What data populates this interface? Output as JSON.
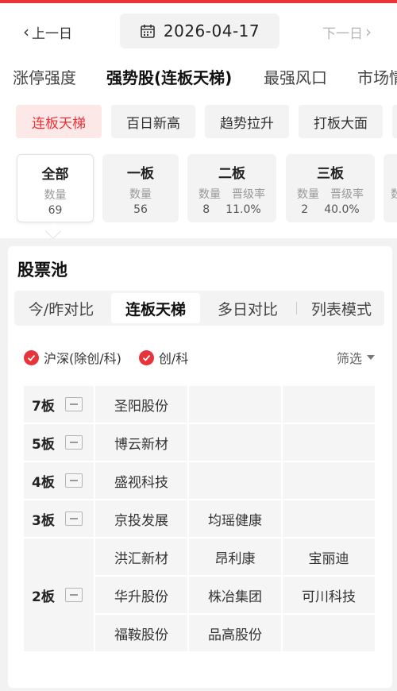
{
  "nav": {
    "prev_label": "上一日",
    "next_label": "下一日",
    "date": "2026-04-17"
  },
  "main_tabs": [
    {
      "label": "涨停强度"
    },
    {
      "label": "强势股(连板天梯)"
    },
    {
      "label": "最强风口"
    },
    {
      "label": "市场情"
    }
  ],
  "chips": [
    {
      "label": "连板天梯"
    },
    {
      "label": "百日新高"
    },
    {
      "label": "趋势拉升"
    },
    {
      "label": "打板大面"
    }
  ],
  "stat_cards": [
    {
      "title": "全部",
      "count_label": "数量",
      "count": "69"
    },
    {
      "title": "一板",
      "count_label": "数量",
      "count": "56"
    },
    {
      "title": "二板",
      "count_label": "数量",
      "count": "8",
      "rate_label": "晋级率",
      "rate": "11.0%"
    },
    {
      "title": "三板",
      "count_label": "数量",
      "count": "2",
      "rate_label": "晋级率",
      "rate": "40.0%"
    },
    {
      "title": "",
      "count_label": "数",
      "count": ""
    }
  ],
  "pool": {
    "title": "股票池",
    "segments": [
      {
        "label": "今/昨对比"
      },
      {
        "label": "连板天梯"
      },
      {
        "label": "多日对比"
      },
      {
        "label": "列表模式"
      }
    ],
    "filters": [
      {
        "label": "沪深(除创/科)"
      },
      {
        "label": "创/科"
      }
    ],
    "screen_label": "筛选"
  },
  "ladder": [
    {
      "level": "7板",
      "stocks": [
        "圣阳股份"
      ]
    },
    {
      "level": "5板",
      "stocks": [
        "博云新材"
      ]
    },
    {
      "level": "4板",
      "stocks": [
        "盛视科技"
      ]
    },
    {
      "level": "3板",
      "stocks": [
        "京投发展",
        "均瑶健康"
      ]
    },
    {
      "level": "2板",
      "stocks": [
        "洪汇新材",
        "昂利康",
        "宝丽迪",
        "华升股份",
        "株冶集团",
        "可川科技",
        "福鞍股份",
        "品高股份"
      ]
    }
  ],
  "colors": {
    "accent": "#e8333a",
    "chip_active_bg": "#fde8e8"
  }
}
